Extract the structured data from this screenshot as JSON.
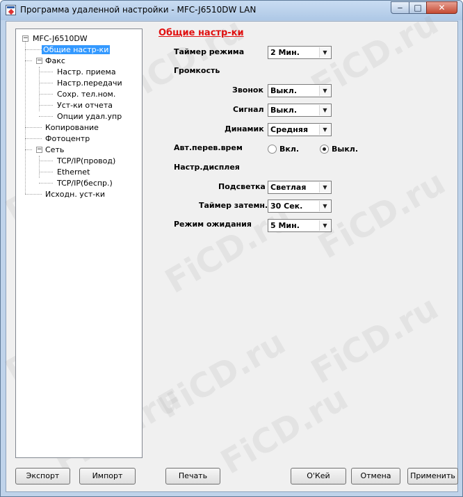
{
  "window": {
    "title": "Программа удаленной настройки - MFC-J6510DW LAN",
    "buttons": {
      "minimize": "‒",
      "maximize": "□",
      "close": "✕"
    }
  },
  "tree": {
    "root": "MFC-J6510DW",
    "items": [
      {
        "label": "Общие настр-ки",
        "selected": true
      },
      {
        "label": "Факс",
        "expanded": true
      },
      {
        "label": "Настр. приема"
      },
      {
        "label": "Настр.передачи"
      },
      {
        "label": "Сохр. тел.ном."
      },
      {
        "label": "Уст-ки отчета"
      },
      {
        "label": "Опции удал.упр"
      },
      {
        "label": "Копирование"
      },
      {
        "label": "Фотоцентр"
      },
      {
        "label": "Сеть",
        "expanded": true
      },
      {
        "label": "TCP/IP(провод)"
      },
      {
        "label": "Ethernet"
      },
      {
        "label": "TCP/IP(беспр.)"
      },
      {
        "label": "Исходн. уст-ки"
      }
    ]
  },
  "panel": {
    "title": "Общие настр-ки",
    "mode_timer": {
      "label": "Таймер режима",
      "value": "2 Мин."
    },
    "volume": {
      "heading": "Громкость",
      "ring": {
        "label": "Звонок",
        "value": "Выкл."
      },
      "beep": {
        "label": "Сигнал",
        "value": "Выкл."
      },
      "speaker": {
        "label": "Динамик",
        "value": "Средняя"
      }
    },
    "auto_dst": {
      "label": "Авт.перев.врем",
      "on": "Вкл.",
      "off": "Выкл.",
      "selected": "off"
    },
    "display": {
      "heading": "Настр.дисплея",
      "backlight": {
        "label": "Подсветка",
        "value": "Светлая"
      },
      "dim_timer": {
        "label": "Таймер затемн.",
        "value": "30 Сек."
      },
      "sleep": {
        "label": "Режим ожидания",
        "value": "5 Мин."
      }
    }
  },
  "buttons": {
    "export": "Экспорт",
    "import": "Импорт",
    "print": "Печать",
    "ok": "O'Кей",
    "cancel": "Отмена",
    "apply": "Применить"
  },
  "watermark": "FiCD.ru",
  "icons": {
    "dropdown": "chevron-down-icon",
    "app": "app-icon"
  }
}
